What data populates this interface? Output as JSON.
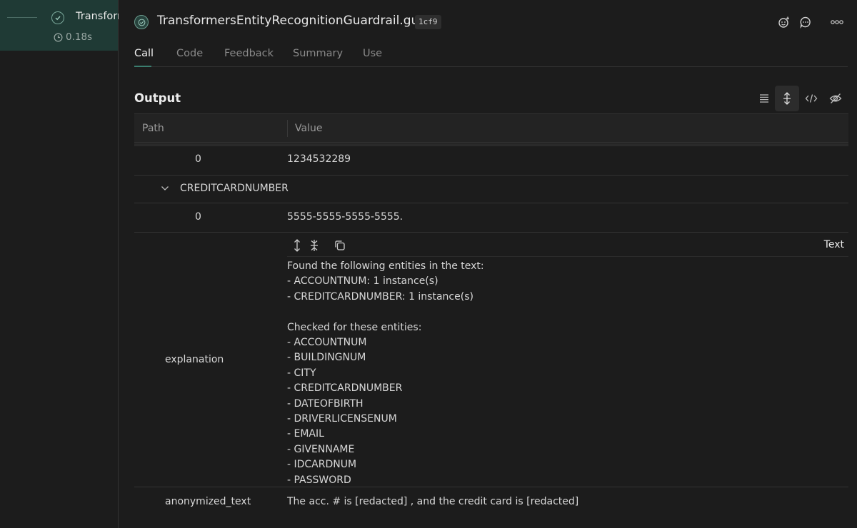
{
  "trace": {
    "name": "Transformers",
    "duration": "0.18s"
  },
  "header": {
    "title": "TransformersEntityRecognitionGuardrail.guard",
    "badge": "1cf9",
    "icons": [
      "emoji-add-icon",
      "comment-icon",
      "more-icon"
    ]
  },
  "tabs": [
    {
      "label": "Call",
      "active": true
    },
    {
      "label": "Code",
      "active": false
    },
    {
      "label": "Feedback",
      "active": false
    },
    {
      "label": "Summary",
      "active": false
    },
    {
      "label": "Use",
      "active": false
    }
  ],
  "output": {
    "title": "Output",
    "icons": [
      "list-view-icon",
      "expand-rows-icon",
      "code-view-icon",
      "hide-icon"
    ]
  },
  "table": {
    "headers": {
      "path": "Path",
      "value": "Value"
    },
    "rows": [
      {
        "key": "0",
        "value": "1234532289"
      },
      {
        "key": "CREDITCARDNUMBER",
        "value": ""
      },
      {
        "key": "0",
        "value": "5555-5555-5555-5555."
      }
    ],
    "explanation": {
      "key": "explanation",
      "mode_label": "Text",
      "text": "Found the following entities in the text:\n- ACCOUNTNUM: 1 instance(s)\n- CREDITCARDNUMBER: 1 instance(s)\n\nChecked for these entities:\n- ACCOUNTNUM\n- BUILDINGNUM\n- CITY\n- CREDITCARDNUMBER\n- DATEOFBIRTH\n- DRIVERLICENSENUM\n- EMAIL\n- GIVENNAME\n- IDCARDNUM\n- PASSWORD"
    },
    "anonymized": {
      "key": "anonymized_text",
      "value": "The acc. # is [redacted] , and the credit card is [redacted]"
    }
  }
}
